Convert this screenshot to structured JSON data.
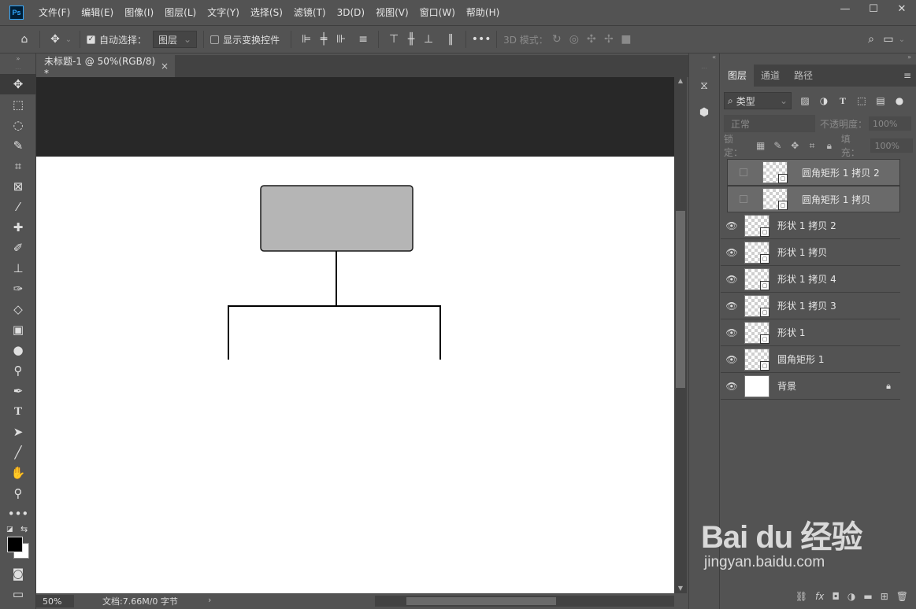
{
  "app": {
    "logo": "Ps"
  },
  "menu": [
    "文件(F)",
    "编辑(E)",
    "图像(I)",
    "图层(L)",
    "文字(Y)",
    "选择(S)",
    "滤镜(T)",
    "3D(D)",
    "视图(V)",
    "窗口(W)",
    "帮助(H)"
  ],
  "window_controls": {
    "minimize": "—",
    "maximize": "☐",
    "close": "✕"
  },
  "options": {
    "auto_select_label": "自动选择：",
    "auto_select_checked": true,
    "auto_select_target": "图层",
    "show_transform_label": "显示变换控件",
    "more": "•••",
    "mode_3d_label": "3D 模式："
  },
  "document_tab": {
    "title": "未标题-1 @ 50%(RGB/8) *",
    "close": "×"
  },
  "status": {
    "zoom": "50%",
    "doc_info": "文档:7.66M/0 字节",
    "arrow": "›"
  },
  "layers_panel": {
    "tabs": [
      "图层",
      "通道",
      "路径"
    ],
    "active_tab": 0,
    "filter_kind": "类型",
    "blend_mode": "正常",
    "opacity_label": "不透明度：",
    "opacity_value": "100%",
    "lock_label": "锁定：",
    "fill_label": "填充：",
    "fill_value": "100%",
    "layers": [
      {
        "name": "圆角矩形 1 拷贝 2",
        "visible": false,
        "selected": true
      },
      {
        "name": "圆角矩形 1 拷贝",
        "visible": false,
        "selected": true
      },
      {
        "name": "形状 1 拷贝 2",
        "visible": true,
        "selected": false
      },
      {
        "name": "形状 1 拷贝",
        "visible": true,
        "selected": false
      },
      {
        "name": "形状 1 拷贝 4",
        "visible": true,
        "selected": false
      },
      {
        "name": "形状 1 拷贝 3",
        "visible": true,
        "selected": false
      },
      {
        "name": "形状 1",
        "visible": true,
        "selected": false
      },
      {
        "name": "圆角矩形 1",
        "visible": true,
        "selected": false
      },
      {
        "name": "背景",
        "visible": true,
        "selected": false,
        "locked": true
      }
    ],
    "footer_fx": "fx"
  },
  "watermark": {
    "brand": "Bai du 经验",
    "url": "jingyan.baidu.com"
  },
  "colors": {
    "shape_fill": "#b5b5b5",
    "shape_stroke": "#1a1a1a",
    "canvas": "#ffffff",
    "pasteboard": "#282828"
  }
}
